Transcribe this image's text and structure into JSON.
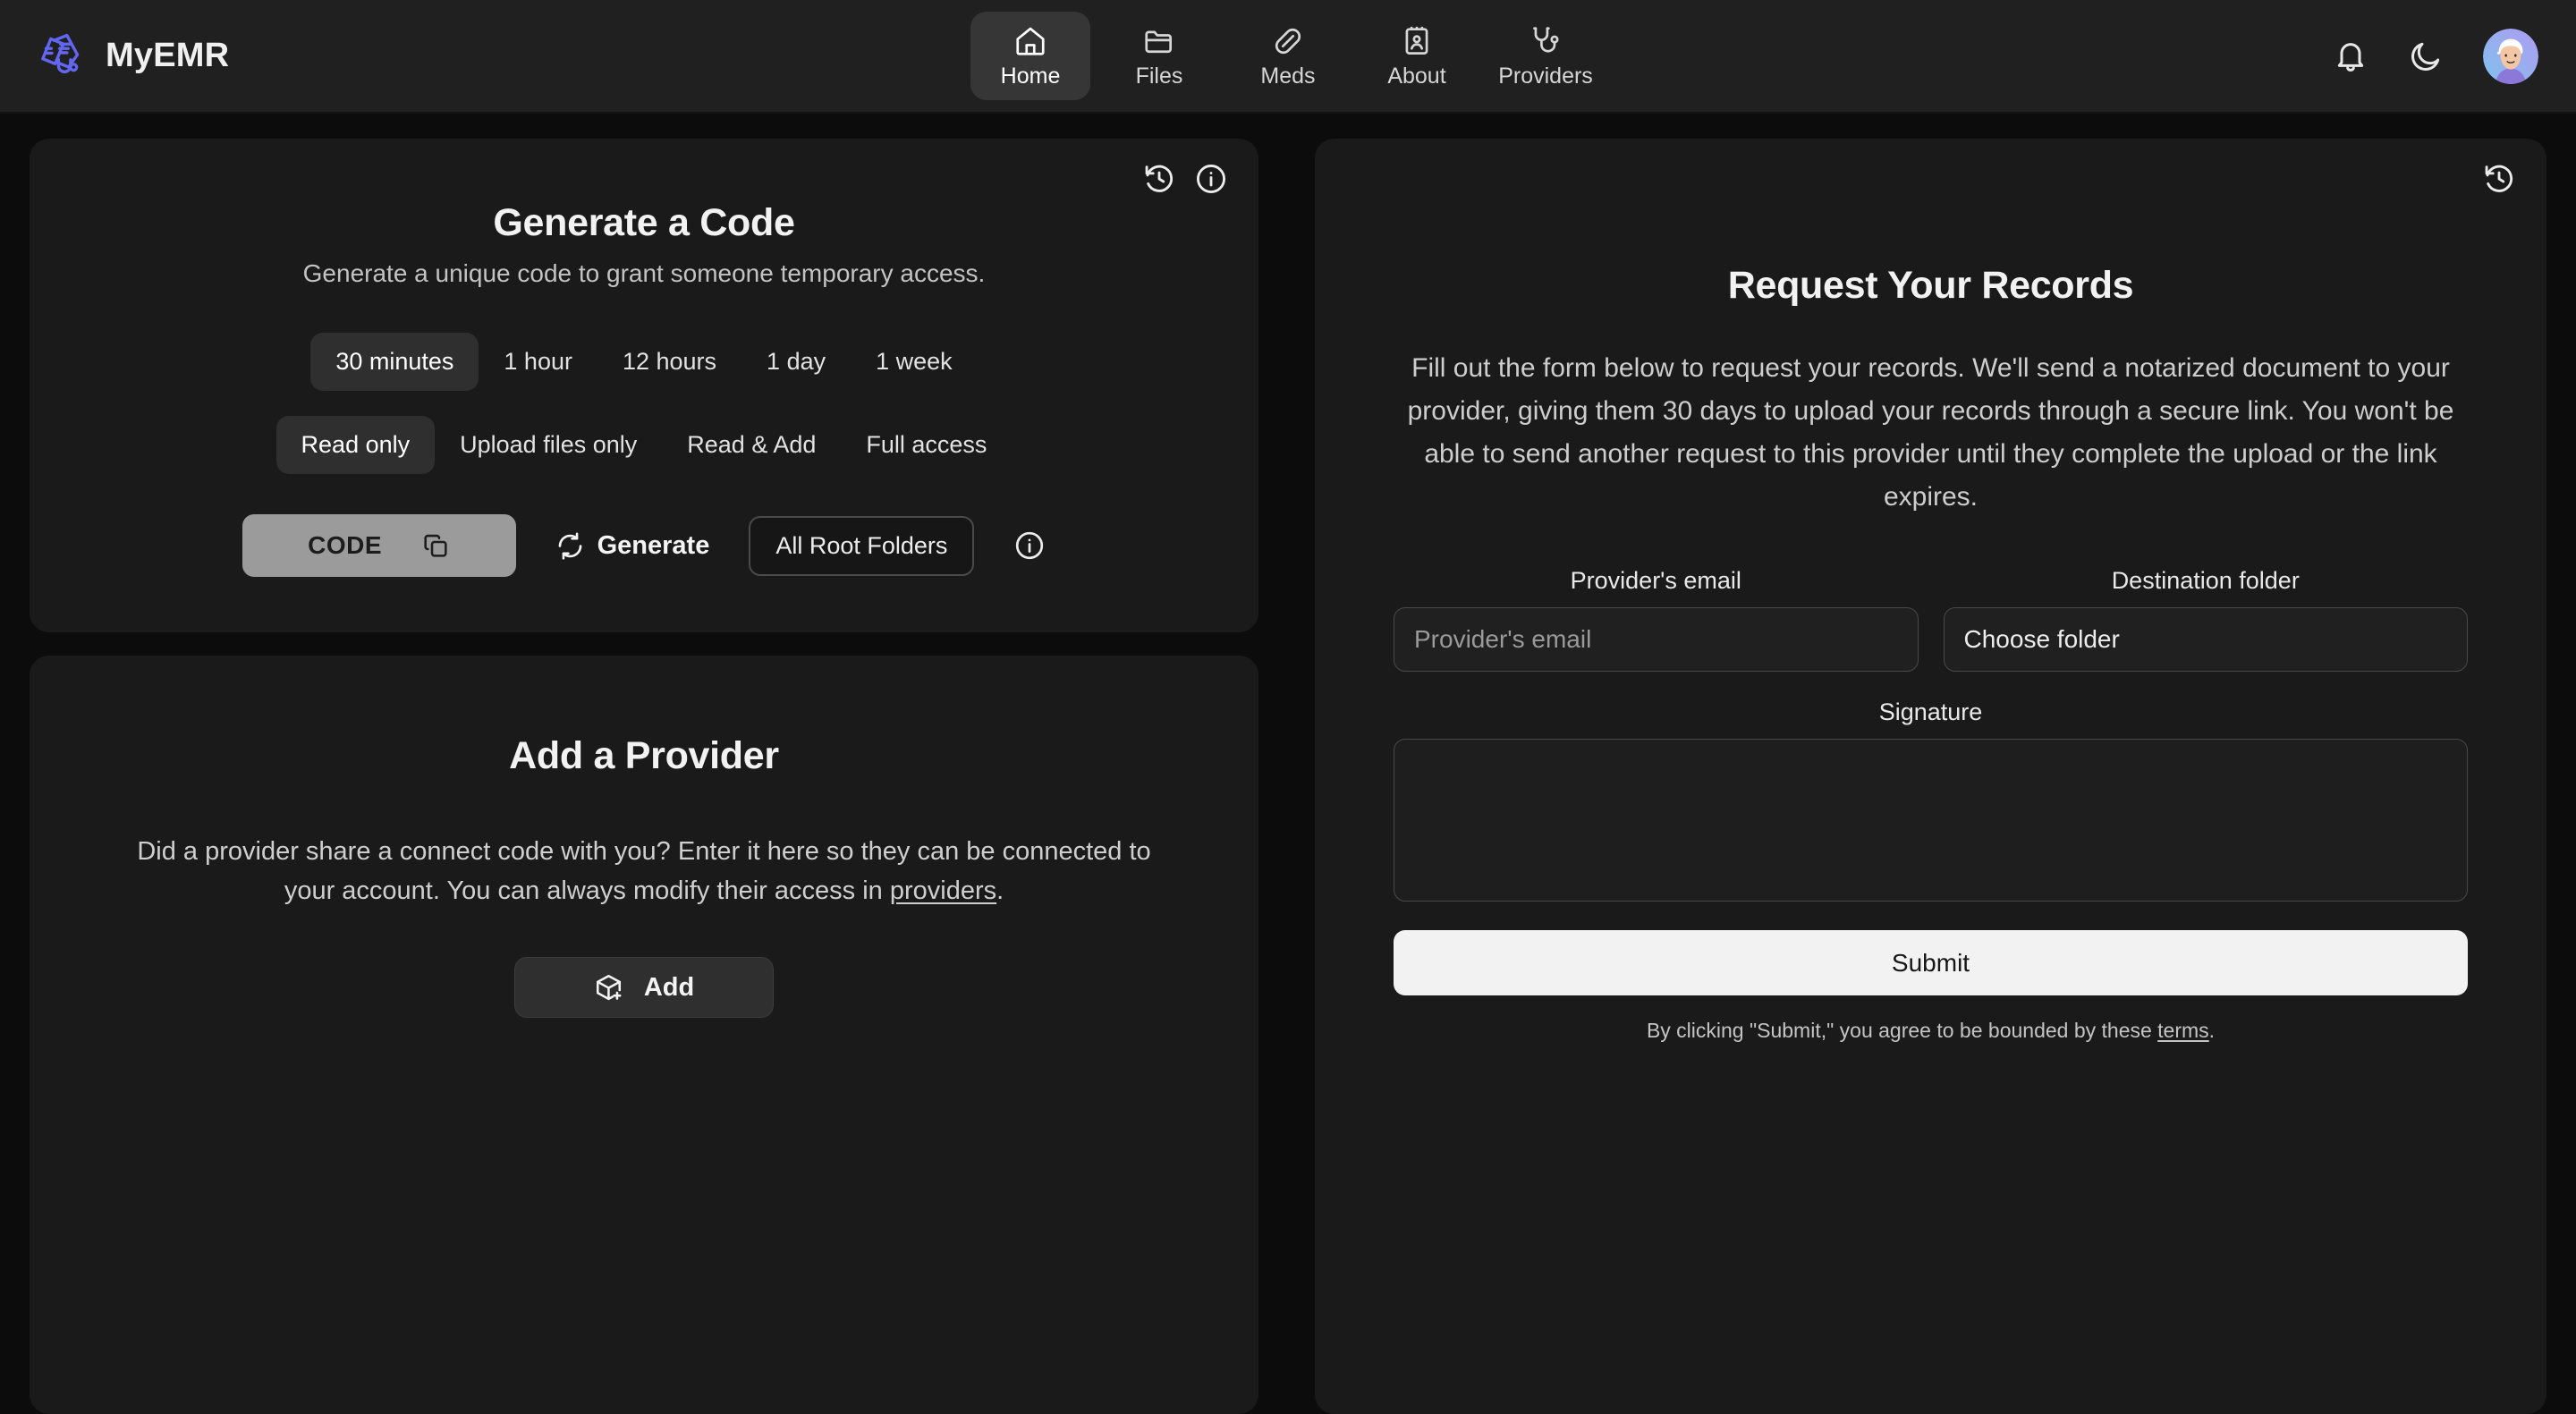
{
  "app": {
    "brand_name": "MyEMR",
    "logo_icon": "medical-records-stethoscope-icon"
  },
  "nav": {
    "items": [
      {
        "label": "Home",
        "icon": "home-icon",
        "active": true
      },
      {
        "label": "Files",
        "icon": "folder-icon",
        "active": false
      },
      {
        "label": "Meds",
        "icon": "pill-icon",
        "active": false
      },
      {
        "label": "About",
        "icon": "id-card-icon",
        "active": false
      },
      {
        "label": "Providers",
        "icon": "stethoscope-icon",
        "active": false
      }
    ]
  },
  "topright": {
    "notifications_icon": "bell-icon",
    "theme_toggle_icon": "moon-icon",
    "avatar_icon": "user-avatar"
  },
  "generate_code": {
    "history_icon": "history-icon",
    "info_icon": "info-circle-icon",
    "title": "Generate a Code",
    "subtitle": "Generate a unique code to grant someone temporary access.",
    "durations": [
      {
        "label": "30 minutes",
        "selected": true
      },
      {
        "label": "1 hour",
        "selected": false
      },
      {
        "label": "12 hours",
        "selected": false
      },
      {
        "label": "1 day",
        "selected": false
      },
      {
        "label": "1 week",
        "selected": false
      }
    ],
    "permissions": [
      {
        "label": "Read only",
        "selected": true
      },
      {
        "label": "Upload files only",
        "selected": false
      },
      {
        "label": "Read & Add",
        "selected": false
      },
      {
        "label": "Full access",
        "selected": false
      }
    ],
    "code_value": "CODE",
    "copy_icon": "copy-icon",
    "generate_label": "Generate",
    "generate_icon": "refresh-icon",
    "folder_scope_label": "All Root Folders",
    "folder_info_icon": "info-circle-icon"
  },
  "add_provider": {
    "title": "Add a Provider",
    "body_before_link": "Did a provider share a connect code with you? Enter it here so they can be connected to your account. You can always modify their access in ",
    "body_link": "providers",
    "body_after_link": ".",
    "add_label": "Add",
    "add_icon": "package-plus-icon"
  },
  "request_records": {
    "history_icon": "history-icon",
    "title": "Request Your Records",
    "description": "Fill out the form below to request your records. We'll send a notarized document to your provider, giving them 30 days to upload your records through a secure link. You won't be able to send another request to this provider until they complete the upload or the link expires.",
    "email_label": "Provider's email",
    "email_placeholder": "Provider's email",
    "email_value": "",
    "folder_label": "Destination folder",
    "folder_value": "Choose folder",
    "signature_label": "Signature",
    "signature_value": "",
    "submit_label": "Submit",
    "terms_before": "By clicking \"Submit,\" you agree to be bounded by these ",
    "terms_link": "terms",
    "terms_after": "."
  },
  "colors": {
    "page_bg": "#0c0c0c",
    "card_bg": "#1a1a1a",
    "header_bg": "#202020",
    "accent_logo": "#6366f1",
    "code_pill": "#9b9b9b",
    "submit_bg": "#f2f2f2"
  }
}
